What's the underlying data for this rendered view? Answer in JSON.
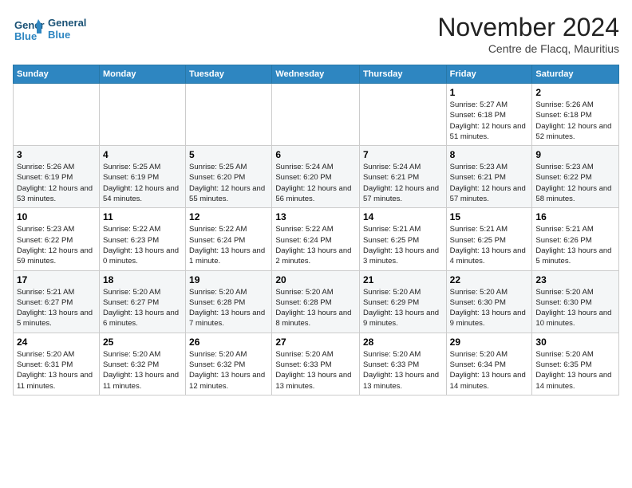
{
  "logo": {
    "line1": "General",
    "line2": "Blue"
  },
  "title": "November 2024",
  "subtitle": "Centre de Flacq, Mauritius",
  "weekdays": [
    "Sunday",
    "Monday",
    "Tuesday",
    "Wednesday",
    "Thursday",
    "Friday",
    "Saturday"
  ],
  "weeks": [
    [
      {
        "day": "",
        "info": ""
      },
      {
        "day": "",
        "info": ""
      },
      {
        "day": "",
        "info": ""
      },
      {
        "day": "",
        "info": ""
      },
      {
        "day": "",
        "info": ""
      },
      {
        "day": "1",
        "info": "Sunrise: 5:27 AM\nSunset: 6:18 PM\nDaylight: 12 hours and 51 minutes."
      },
      {
        "day": "2",
        "info": "Sunrise: 5:26 AM\nSunset: 6:18 PM\nDaylight: 12 hours and 52 minutes."
      }
    ],
    [
      {
        "day": "3",
        "info": "Sunrise: 5:26 AM\nSunset: 6:19 PM\nDaylight: 12 hours and 53 minutes."
      },
      {
        "day": "4",
        "info": "Sunrise: 5:25 AM\nSunset: 6:19 PM\nDaylight: 12 hours and 54 minutes."
      },
      {
        "day": "5",
        "info": "Sunrise: 5:25 AM\nSunset: 6:20 PM\nDaylight: 12 hours and 55 minutes."
      },
      {
        "day": "6",
        "info": "Sunrise: 5:24 AM\nSunset: 6:20 PM\nDaylight: 12 hours and 56 minutes."
      },
      {
        "day": "7",
        "info": "Sunrise: 5:24 AM\nSunset: 6:21 PM\nDaylight: 12 hours and 57 minutes."
      },
      {
        "day": "8",
        "info": "Sunrise: 5:23 AM\nSunset: 6:21 PM\nDaylight: 12 hours and 57 minutes."
      },
      {
        "day": "9",
        "info": "Sunrise: 5:23 AM\nSunset: 6:22 PM\nDaylight: 12 hours and 58 minutes."
      }
    ],
    [
      {
        "day": "10",
        "info": "Sunrise: 5:23 AM\nSunset: 6:22 PM\nDaylight: 12 hours and 59 minutes."
      },
      {
        "day": "11",
        "info": "Sunrise: 5:22 AM\nSunset: 6:23 PM\nDaylight: 13 hours and 0 minutes."
      },
      {
        "day": "12",
        "info": "Sunrise: 5:22 AM\nSunset: 6:24 PM\nDaylight: 13 hours and 1 minute."
      },
      {
        "day": "13",
        "info": "Sunrise: 5:22 AM\nSunset: 6:24 PM\nDaylight: 13 hours and 2 minutes."
      },
      {
        "day": "14",
        "info": "Sunrise: 5:21 AM\nSunset: 6:25 PM\nDaylight: 13 hours and 3 minutes."
      },
      {
        "day": "15",
        "info": "Sunrise: 5:21 AM\nSunset: 6:25 PM\nDaylight: 13 hours and 4 minutes."
      },
      {
        "day": "16",
        "info": "Sunrise: 5:21 AM\nSunset: 6:26 PM\nDaylight: 13 hours and 5 minutes."
      }
    ],
    [
      {
        "day": "17",
        "info": "Sunrise: 5:21 AM\nSunset: 6:27 PM\nDaylight: 13 hours and 5 minutes."
      },
      {
        "day": "18",
        "info": "Sunrise: 5:20 AM\nSunset: 6:27 PM\nDaylight: 13 hours and 6 minutes."
      },
      {
        "day": "19",
        "info": "Sunrise: 5:20 AM\nSunset: 6:28 PM\nDaylight: 13 hours and 7 minutes."
      },
      {
        "day": "20",
        "info": "Sunrise: 5:20 AM\nSunset: 6:28 PM\nDaylight: 13 hours and 8 minutes."
      },
      {
        "day": "21",
        "info": "Sunrise: 5:20 AM\nSunset: 6:29 PM\nDaylight: 13 hours and 9 minutes."
      },
      {
        "day": "22",
        "info": "Sunrise: 5:20 AM\nSunset: 6:30 PM\nDaylight: 13 hours and 9 minutes."
      },
      {
        "day": "23",
        "info": "Sunrise: 5:20 AM\nSunset: 6:30 PM\nDaylight: 13 hours and 10 minutes."
      }
    ],
    [
      {
        "day": "24",
        "info": "Sunrise: 5:20 AM\nSunset: 6:31 PM\nDaylight: 13 hours and 11 minutes."
      },
      {
        "day": "25",
        "info": "Sunrise: 5:20 AM\nSunset: 6:32 PM\nDaylight: 13 hours and 11 minutes."
      },
      {
        "day": "26",
        "info": "Sunrise: 5:20 AM\nSunset: 6:32 PM\nDaylight: 13 hours and 12 minutes."
      },
      {
        "day": "27",
        "info": "Sunrise: 5:20 AM\nSunset: 6:33 PM\nDaylight: 13 hours and 13 minutes."
      },
      {
        "day": "28",
        "info": "Sunrise: 5:20 AM\nSunset: 6:33 PM\nDaylight: 13 hours and 13 minutes."
      },
      {
        "day": "29",
        "info": "Sunrise: 5:20 AM\nSunset: 6:34 PM\nDaylight: 13 hours and 14 minutes."
      },
      {
        "day": "30",
        "info": "Sunrise: 5:20 AM\nSunset: 6:35 PM\nDaylight: 13 hours and 14 minutes."
      }
    ]
  ]
}
